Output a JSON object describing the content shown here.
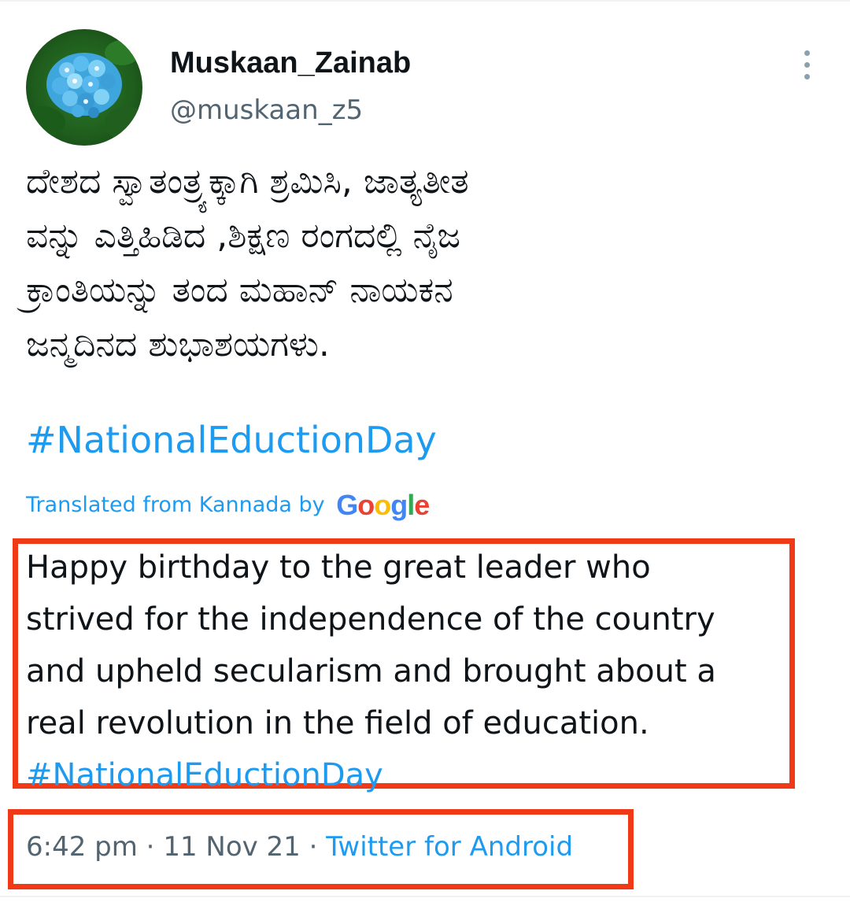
{
  "author": {
    "display_name": "Muskaan_Zainab",
    "handle": "@muskaan_z5"
  },
  "tweet": {
    "lines": [
      "ದೇಶದ ಸ್ವಾತಂತ್ರ್ಯಕ್ಕಾಗಿ ಶ್ರಮಿಸಿ, ಜಾತ್ಯತೀತ",
      "ವನ್ನು ಎತ್ತಿಹಿಡಿದ ,ಶಿಕ್ಷಣ ರಂಗದಲ್ಲಿ ನೈಜ",
      "ಕ್ರಾಂತಿಯನ್ನು ತಂದ  ಮಹಾನ್ ನಾಯಕನ",
      "ಜನ್ಮದಿನದ ಶುಭಾಶಯಗಳು."
    ],
    "hashtag": "#NationalEductionDay"
  },
  "translation": {
    "label": "Translated from Kannada by",
    "provider": "Google",
    "lines": [
      "Happy birthday to the great leader who",
      "strived for the independence of the country",
      "and upheld secularism and brought about a",
      "real revolution in the field of education."
    ],
    "hashtag": " #NationalEductionDay"
  },
  "meta": {
    "time": "6:42 pm",
    "separator": " · ",
    "date": "11 Nov 21",
    "source": "Twitter for Android"
  },
  "colors": {
    "link": "#1d9bf0",
    "secondary_text": "#536471",
    "highlight_box": "#f03a17"
  },
  "icons": {
    "more": "more-vertical-icon",
    "avatar": "blue-hydrangea-photo"
  }
}
